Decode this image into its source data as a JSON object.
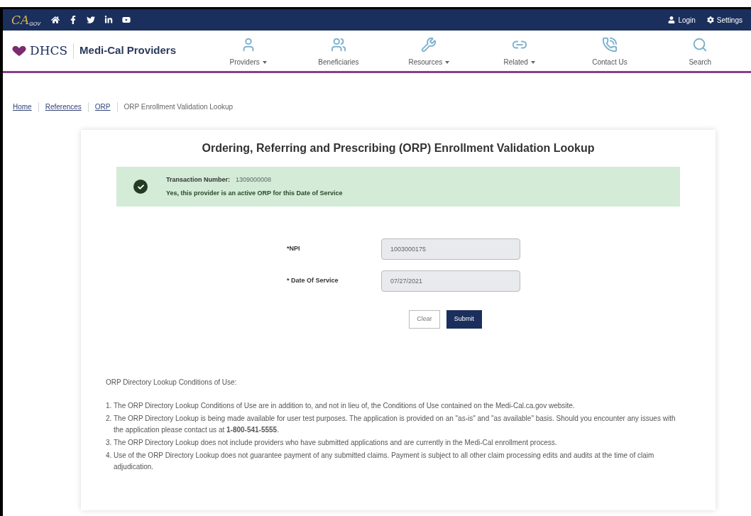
{
  "top_bar": {
    "logo": {
      "main": "CA",
      "sub": "GOV"
    },
    "social": [
      {
        "kind": "home"
      },
      {
        "kind": "facebook"
      },
      {
        "kind": "twitter"
      },
      {
        "kind": "linkedin"
      },
      {
        "kind": "youtube"
      }
    ],
    "links": [
      {
        "kind": "user",
        "label": "Login"
      },
      {
        "kind": "gear",
        "label": "Settings"
      }
    ]
  },
  "header": {
    "agency": "DHCS",
    "site_title": "Medi-Cal Providers",
    "nav": [
      {
        "kind": "person",
        "label": "Providers",
        "dropdown": true
      },
      {
        "kind": "people",
        "label": "Beneficiaries",
        "dropdown": false
      },
      {
        "kind": "tools",
        "label": "Resources",
        "dropdown": true
      },
      {
        "kind": "link",
        "label": "Related",
        "dropdown": true
      },
      {
        "kind": "contact",
        "label": "Contact Us",
        "dropdown": false
      },
      {
        "kind": "search",
        "label": "Search",
        "dropdown": false
      }
    ]
  },
  "breadcrumb": [
    {
      "label": "Home",
      "link": true
    },
    {
      "label": "References",
      "link": true
    },
    {
      "label": "ORP",
      "link": true
    },
    {
      "label": "ORP Enrollment Validation Lookup",
      "link": false
    }
  ],
  "card": {
    "title": "Ordering, Referring and Prescribing (ORP) Enrollment Validation Lookup",
    "alert": {
      "kind": "success",
      "label": "Transaction Number:",
      "number": "1309000008",
      "message": "Yes, this provider is an active ORP for this Date of Service"
    },
    "fields": [
      {
        "required_mark": "*",
        "label": "NPI",
        "value": "1003000175"
      },
      {
        "required_mark": "* ",
        "label": "Date Of Service",
        "value": "07/27/2021"
      }
    ],
    "buttons": [
      {
        "kind": "secondary",
        "label": "Clear"
      },
      {
        "kind": "primary",
        "label": "Submit"
      }
    ],
    "conditions": {
      "heading": "ORP Directory Lookup Conditions of Use:",
      "items": [
        {
          "number": "1.",
          "text": "The ORP Directory Lookup Conditions of Use are in addition to, and not in lieu of, the Conditions of Use contained on the Medi-Cal.ca.gov website."
        },
        {
          "number": "2.",
          "text": "The ORP Directory Lookup is being made available for user test purposes. The application is provided on an \"as-is\" and \"as available\" basis. Should you encounter any issues with the application please contact us at **1-800-541-5555**."
        },
        {
          "number": "3.",
          "text": "The ORP Directory Lookup does not include providers who have submitted applications and are currently in the Medi-Cal enrollment process."
        },
        {
          "number": "4.",
          "text": "Use of the ORP Directory Lookup does not guarantee payment of any submitted claims. Payment is subject to all other claim processing edits and audits at the time of claim adjudication."
        }
      ]
    }
  }
}
